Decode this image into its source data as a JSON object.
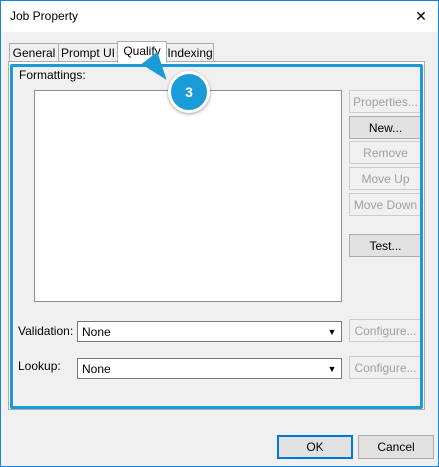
{
  "window": {
    "title": "Job Property",
    "close_glyph": "✕"
  },
  "tabs": [
    {
      "label": "General"
    },
    {
      "label": "Prompt UI"
    },
    {
      "label": "Qualify"
    },
    {
      "label": "Indexing"
    }
  ],
  "active_tab": "Qualify",
  "qualify": {
    "formattings_label": "Formattings:",
    "buttons": {
      "properties": "Properties...",
      "new": "New...",
      "remove": "Remove",
      "move_up": "Move Up",
      "move_down": "Move Down",
      "test": "Test..."
    },
    "validation": {
      "label": "Validation:",
      "value": "None",
      "configure": "Configure..."
    },
    "lookup": {
      "label": "Lookup:",
      "value": "None",
      "configure": "Configure..."
    }
  },
  "footer": {
    "ok": "OK",
    "cancel": "Cancel"
  },
  "annotation": {
    "number": "3",
    "color": "#1a9bd7"
  }
}
